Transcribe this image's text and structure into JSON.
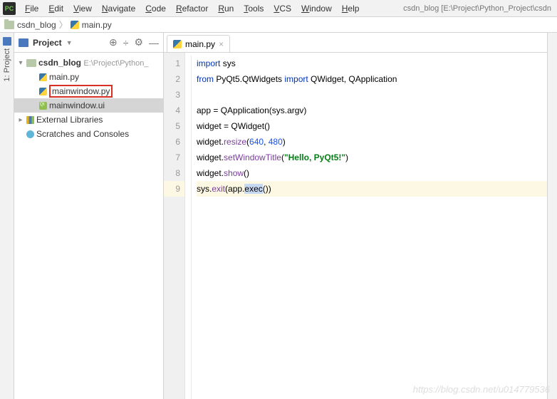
{
  "menubar": {
    "items": [
      "File",
      "Edit",
      "View",
      "Navigate",
      "Code",
      "Refactor",
      "Run",
      "Tools",
      "VCS",
      "Window",
      "Help"
    ],
    "project_path": "csdn_blog [E:\\Project\\Python_Project\\csdn"
  },
  "breadcrumb": {
    "folder": "csdn_blog",
    "file": "main.py"
  },
  "left_stripe": {
    "label": "1: Project"
  },
  "sidebar": {
    "title": "Project",
    "tree": {
      "root": {
        "name": "csdn_blog",
        "path": "E:\\Project\\Python_"
      },
      "files": [
        {
          "name": "main.py",
          "type": "py"
        },
        {
          "name": "mainwindow.py",
          "type": "py",
          "highlight": true
        },
        {
          "name": "mainwindow.ui",
          "type": "ui",
          "selected": true
        }
      ],
      "ext_lib": "External Libraries",
      "scratches": "Scratches and Consoles"
    }
  },
  "editor": {
    "tab": {
      "name": "main.py"
    },
    "lines": [
      {
        "n": 1,
        "tokens": [
          {
            "t": "kw",
            "v": "import"
          },
          {
            "t": "op",
            "v": " "
          },
          {
            "t": "cls",
            "v": "sys"
          }
        ]
      },
      {
        "n": 2,
        "tokens": [
          {
            "t": "kw",
            "v": "from"
          },
          {
            "t": "op",
            "v": " PyQt5.QtWidgets "
          },
          {
            "t": "kw",
            "v": "import"
          },
          {
            "t": "op",
            "v": " QWidget, QApplication"
          }
        ]
      },
      {
        "n": 3,
        "tokens": []
      },
      {
        "n": 4,
        "tokens": [
          {
            "t": "op",
            "v": "app = "
          },
          {
            "t": "cls",
            "v": "QApplication"
          },
          {
            "t": "op",
            "v": "(sys.argv)"
          }
        ]
      },
      {
        "n": 5,
        "tokens": [
          {
            "t": "op",
            "v": "widget = "
          },
          {
            "t": "cls",
            "v": "QWidget"
          },
          {
            "t": "op",
            "v": "()"
          }
        ]
      },
      {
        "n": 6,
        "tokens": [
          {
            "t": "op",
            "v": "widget."
          },
          {
            "t": "fn",
            "v": "resize"
          },
          {
            "t": "op",
            "v": "("
          },
          {
            "t": "num",
            "v": "640"
          },
          {
            "t": "op",
            "v": ", "
          },
          {
            "t": "num",
            "v": "480"
          },
          {
            "t": "op",
            "v": ")"
          }
        ]
      },
      {
        "n": 7,
        "tokens": [
          {
            "t": "op",
            "v": "widget."
          },
          {
            "t": "fn",
            "v": "setWindowTitle"
          },
          {
            "t": "op",
            "v": "("
          },
          {
            "t": "str",
            "v": "\"Hello, PyQt5!\""
          },
          {
            "t": "op",
            "v": ")"
          }
        ]
      },
      {
        "n": 8,
        "tokens": [
          {
            "t": "op",
            "v": "widget."
          },
          {
            "t": "fn",
            "v": "show"
          },
          {
            "t": "op",
            "v": "()"
          }
        ]
      },
      {
        "n": 9,
        "current": true,
        "tokens": [
          {
            "t": "op",
            "v": "sys."
          },
          {
            "t": "fn",
            "v": "exit"
          },
          {
            "t": "op",
            "v": "(app."
          },
          {
            "t": "caret-mark",
            "v": "exec"
          },
          {
            "t": "op",
            "v": "())"
          }
        ]
      }
    ]
  },
  "watermark": "https://blog.csdn.net/u014779536"
}
